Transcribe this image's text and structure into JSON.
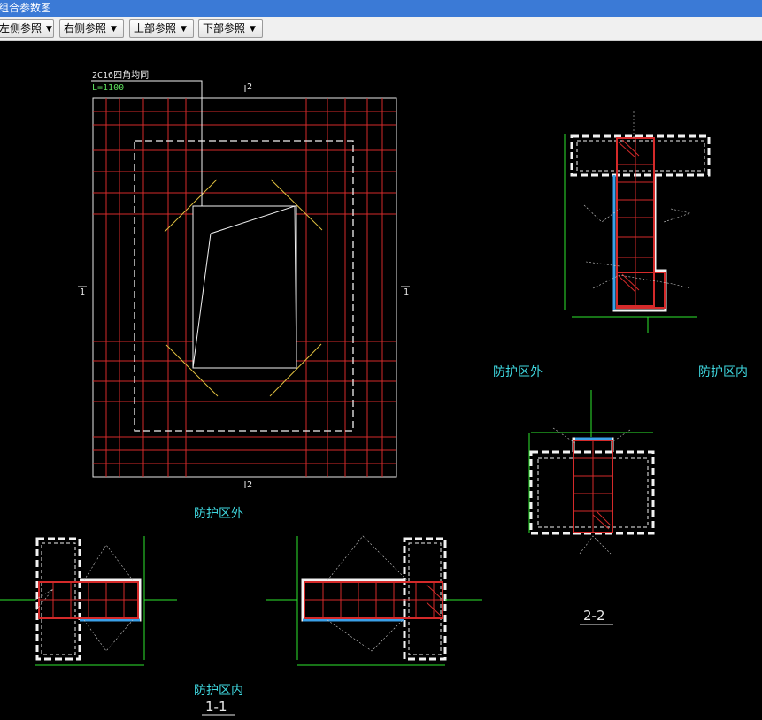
{
  "window": {
    "title": "组合参数图"
  },
  "toolbar": {
    "left_ref": "左侧参照",
    "right_ref": "右侧参照",
    "top_ref": "上部参照",
    "bottom_ref": "下部参照"
  },
  "plan": {
    "rebar_note": "2C16四角均同",
    "length_note": "L=1100",
    "cut_top": "2",
    "cut_bottom": "2",
    "cut_left": "1",
    "cut_right": "1"
  },
  "zones": {
    "outside_center": "防护区外",
    "outside_right": "防护区外",
    "inside_right": "防护区内",
    "inside_bottom": "防护区内"
  },
  "sections": {
    "section_1": "1-1",
    "section_2": "2-2"
  },
  "colors": {
    "titlebar": "#3b7ad6",
    "rebar": "#d42a2a",
    "dim": "#2ee62e",
    "zone_text": "#3fd8e0",
    "face": "#3aa0e8"
  }
}
